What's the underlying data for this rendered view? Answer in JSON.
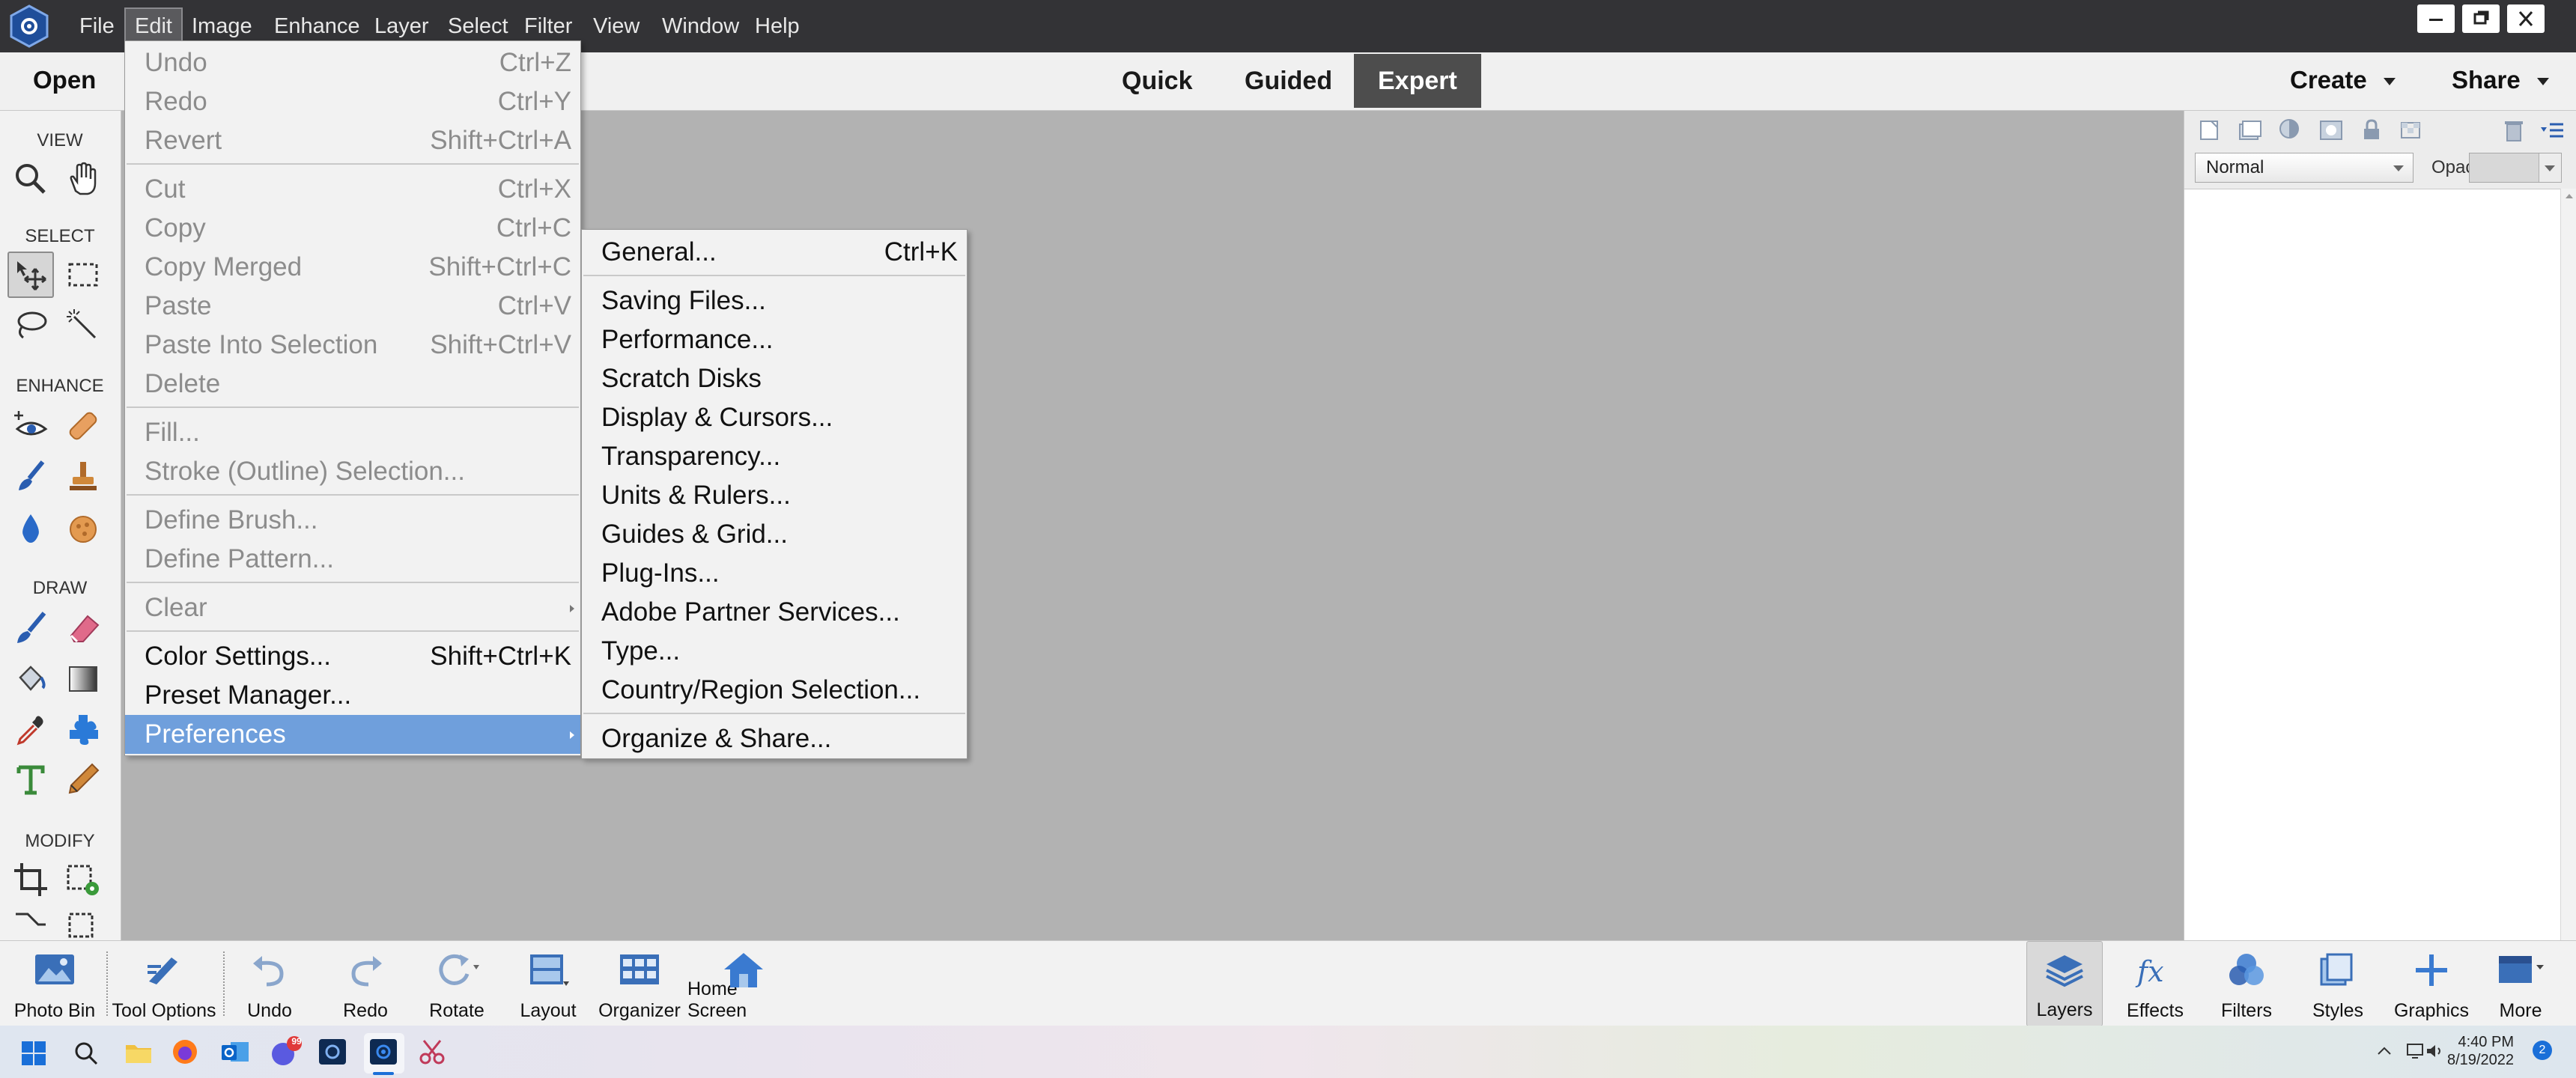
{
  "menubar": {
    "items": [
      "File",
      "Edit",
      "Image",
      "Enhance",
      "Layer",
      "Select",
      "Filter",
      "View",
      "Window",
      "Help"
    ],
    "active": "Edit"
  },
  "modebar": {
    "open_label": "Open",
    "modes": [
      "Quick",
      "Guided",
      "Expert"
    ],
    "selected_mode": "Expert",
    "create_label": "Create",
    "share_label": "Share"
  },
  "toolbar": {
    "sections": {
      "view": "VIEW",
      "select": "SELECT",
      "enhance": "ENHANCE",
      "draw": "DRAW",
      "modify": "MODIFY"
    }
  },
  "edit_menu": {
    "items": [
      {
        "label": "Undo",
        "shortcut": "Ctrl+Z",
        "enabled": false
      },
      {
        "label": "Redo",
        "shortcut": "Ctrl+Y",
        "enabled": false
      },
      {
        "label": "Revert",
        "shortcut": "Shift+Ctrl+A",
        "enabled": false
      },
      {
        "label": "Cut",
        "shortcut": "Ctrl+X",
        "enabled": false
      },
      {
        "label": "Copy",
        "shortcut": "Ctrl+C",
        "enabled": false
      },
      {
        "label": "Copy Merged",
        "shortcut": "Shift+Ctrl+C",
        "enabled": false
      },
      {
        "label": "Paste",
        "shortcut": "Ctrl+V",
        "enabled": false
      },
      {
        "label": "Paste Into Selection",
        "shortcut": "Shift+Ctrl+V",
        "enabled": false
      },
      {
        "label": "Delete",
        "shortcut": "",
        "enabled": false
      },
      {
        "label": "Fill...",
        "shortcut": "",
        "enabled": false
      },
      {
        "label": "Stroke (Outline) Selection...",
        "shortcut": "",
        "enabled": false
      },
      {
        "label": "Define Brush...",
        "shortcut": "",
        "enabled": false
      },
      {
        "label": "Define Pattern...",
        "shortcut": "",
        "enabled": false
      },
      {
        "label": "Clear",
        "shortcut": "",
        "enabled": false
      },
      {
        "label": "Color Settings...",
        "shortcut": "Shift+Ctrl+K",
        "enabled": true
      },
      {
        "label": "Preset Manager...",
        "shortcut": "",
        "enabled": true
      },
      {
        "label": "Preferences",
        "shortcut": "",
        "enabled": true
      }
    ]
  },
  "preferences_menu": {
    "items": [
      {
        "label": "General...",
        "shortcut": "Ctrl+K"
      },
      {
        "label": "Saving Files...",
        "shortcut": ""
      },
      {
        "label": "Performance...",
        "shortcut": ""
      },
      {
        "label": "Scratch Disks",
        "shortcut": ""
      },
      {
        "label": "Display & Cursors...",
        "shortcut": ""
      },
      {
        "label": "Transparency...",
        "shortcut": ""
      },
      {
        "label": "Units & Rulers...",
        "shortcut": ""
      },
      {
        "label": "Guides & Grid...",
        "shortcut": ""
      },
      {
        "label": "Plug-Ins...",
        "shortcut": ""
      },
      {
        "label": "Adobe Partner Services...",
        "shortcut": ""
      },
      {
        "label": "Type...",
        "shortcut": ""
      },
      {
        "label": "Country/Region Selection...",
        "shortcut": ""
      },
      {
        "label": "Organize & Share...",
        "shortcut": ""
      }
    ]
  },
  "layers_panel": {
    "blend_mode": "Normal",
    "opacity_label": "Opacity:"
  },
  "bottombar": {
    "left": [
      "Photo Bin",
      "Tool Options",
      "Undo",
      "Redo",
      "Rotate",
      "Layout",
      "Organizer",
      "Home Screen"
    ],
    "right": [
      "Layers",
      "Effects",
      "Filters",
      "Styles",
      "Graphics",
      "More"
    ]
  },
  "taskbar": {
    "time": "4:40 PM",
    "date": "8/19/2022",
    "notification_count": "2",
    "chat_badge": "99"
  },
  "colors": {
    "accent_highlight": "#6f9fdc",
    "titlebar": "#333336",
    "canvas": "#b2b2b2",
    "expert_tab": "#4d4d4d"
  }
}
